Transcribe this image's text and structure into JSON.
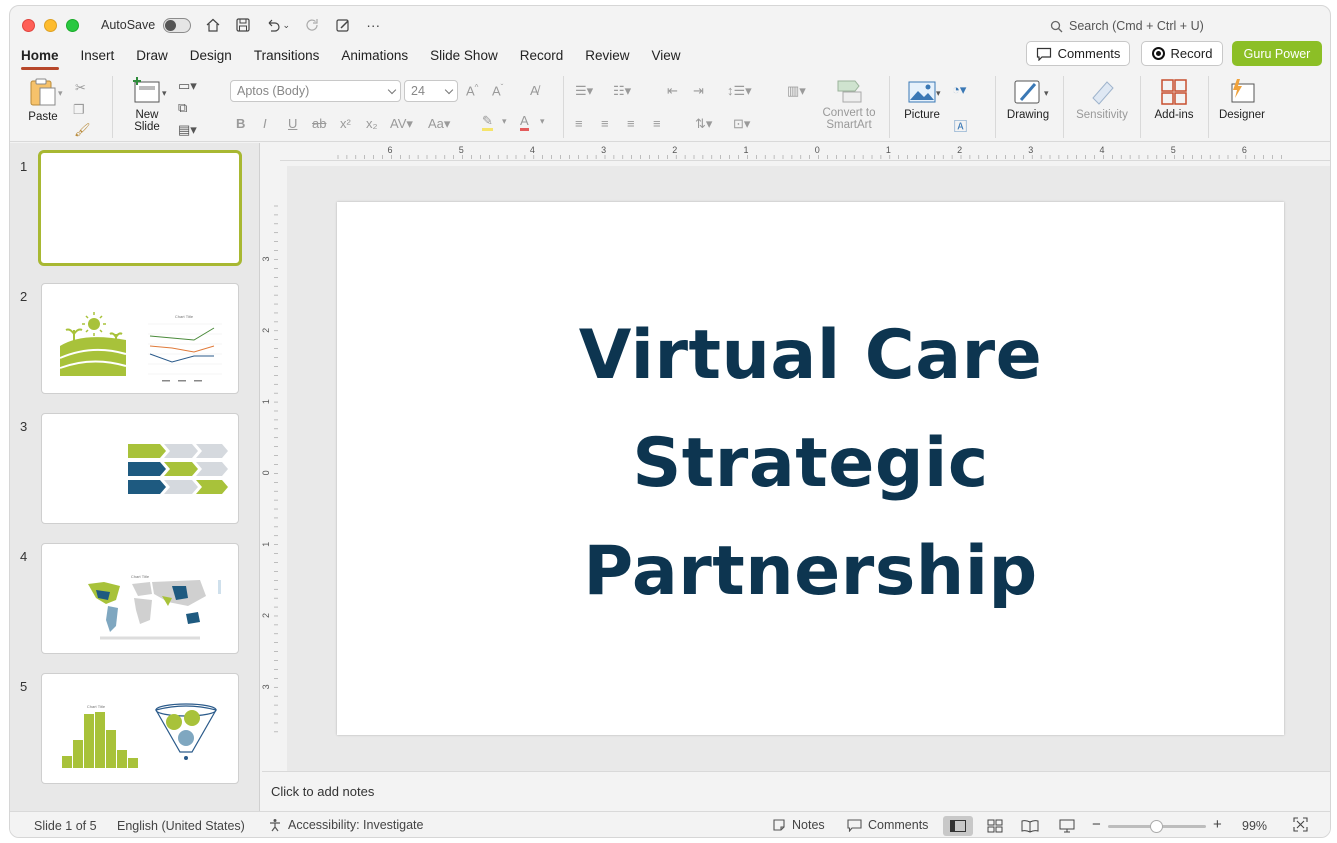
{
  "titlebar": {
    "autosave_label": "AutoSave",
    "search_placeholder": "Search (Cmd + Ctrl + U)"
  },
  "tabs": [
    {
      "label": "Home",
      "active": true
    },
    {
      "label": "Insert"
    },
    {
      "label": "Draw"
    },
    {
      "label": "Design"
    },
    {
      "label": "Transitions"
    },
    {
      "label": "Animations"
    },
    {
      "label": "Slide Show"
    },
    {
      "label": "Record"
    },
    {
      "label": "Review"
    },
    {
      "label": "View"
    }
  ],
  "header_buttons": {
    "comments": "Comments",
    "record": "Record",
    "guru": "Guru Power"
  },
  "ribbon": {
    "paste": "Paste",
    "new_slide_line1": "New",
    "new_slide_line2": "Slide",
    "font_name": "Aptos (Body)",
    "font_size": "24",
    "convert_line1": "Convert to",
    "convert_line2": "SmartArt",
    "picture": "Picture",
    "drawing": "Drawing",
    "sensitivity": "Sensitivity",
    "addins": "Add-ins",
    "designer": "Designer"
  },
  "slides_panel": {
    "numbers": [
      "1",
      "2",
      "3",
      "4",
      "5"
    ],
    "thumb2_chart_title": "Chart Title",
    "thumb4_chart_title": "Chart Title",
    "thumb5_chart_title": "Chart Title"
  },
  "ruler": {
    "h_labels": [
      "6",
      "5",
      "4",
      "3",
      "2",
      "1",
      "0",
      "1",
      "2",
      "3",
      "4",
      "5",
      "6"
    ],
    "v_labels": [
      "3",
      "2",
      "1",
      "0",
      "1",
      "2",
      "3"
    ]
  },
  "slide": {
    "title_line1": "Virtual Care",
    "title_line2": "Strategic",
    "title_line3": "Partnership"
  },
  "notes": {
    "placeholder": "Click to add notes"
  },
  "status": {
    "slide_count": "Slide 1 of 5",
    "language": "English (United States)",
    "accessibility": "Accessibility: Investigate",
    "notes_btn": "Notes",
    "comments_btn": "Comments",
    "zoom": "99%"
  },
  "colors": {
    "accent": "#8cbf26",
    "title_text": "#0d3550",
    "tab_underline": "#b7472a"
  }
}
